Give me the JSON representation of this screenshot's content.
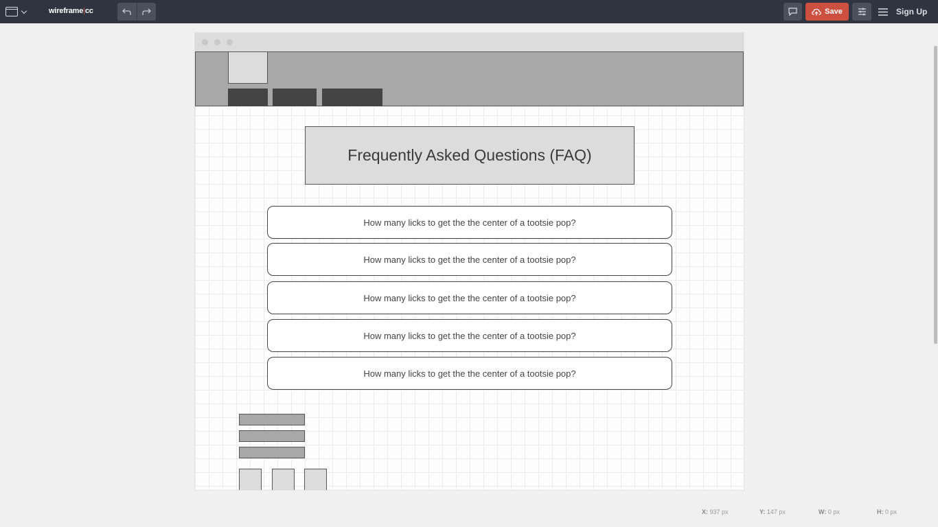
{
  "app": {
    "logo_main": "wireframe",
    "logo_sep": "|",
    "logo_suffix": "cc"
  },
  "toolbar": {
    "undo_icon": "undo-arrow",
    "redo_icon": "redo-arrow",
    "save_label": "Save",
    "signup_label": "Sign Up"
  },
  "wireframe": {
    "title": "Frequently Asked Questions (FAQ)",
    "faq_items": [
      "How many licks to get the the center of a tootsie pop?",
      "How many licks to get the the center of a tootsie pop?",
      "How many licks to get the the center of a tootsie pop?",
      "How many licks to get the the center of a tootsie pop?",
      "How many licks to get the the center of a tootsie pop?"
    ]
  },
  "status": {
    "x_label": "X:",
    "x_value": "937 px",
    "y_label": "Y:",
    "y_value": "147 px",
    "w_label": "W:",
    "w_value": "0 px",
    "h_label": "H:",
    "h_value": "0 px"
  },
  "colors": {
    "toolbar_bg": "#2e3440",
    "save_accent": "#cc5040"
  }
}
